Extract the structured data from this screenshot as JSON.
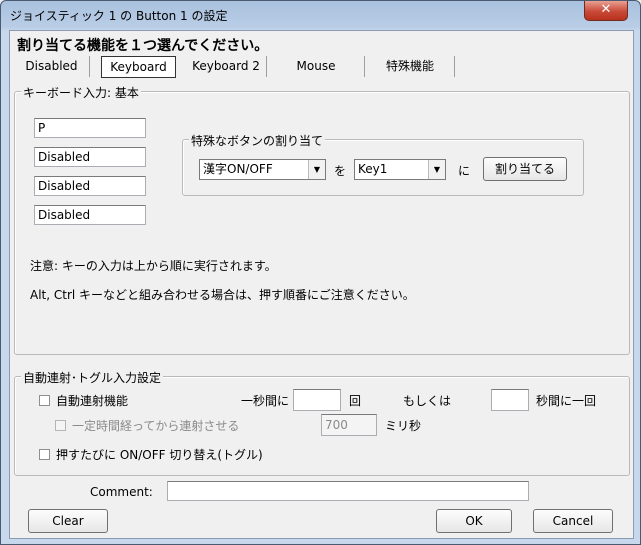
{
  "window": {
    "title": "ジョイスティック 1 の Button 1 の設定",
    "close_glyph": "✕"
  },
  "heading": "割り当てる機能を１つ選んでください。",
  "tabs": [
    {
      "label": "Disabled"
    },
    {
      "label": "Keyboard"
    },
    {
      "label": "Keyboard 2"
    },
    {
      "label": "Mouse"
    },
    {
      "label": "特殊機能"
    }
  ],
  "keyboard_group": {
    "title": "キーボード入力: 基本",
    "keys": [
      "P",
      "Disabled",
      "Disabled",
      "Disabled"
    ],
    "special": {
      "title": "特殊なボタンの割り当て",
      "combo1": "漢字ON/OFF",
      "wo": "を",
      "combo2": "Key1",
      "ni": "に",
      "assign_label": "割り当てる"
    },
    "note1": "注意: キーの入力は上から順に実行されます。",
    "note2": "Alt, Ctrl キーなどと組み合わせる場合は、押す順番にご注意ください。"
  },
  "auto_group": {
    "title": "自動連射･トグル入力設定",
    "auto_fire_label": "自動連射機能",
    "per_second_label": "一秒間に",
    "times_label": "回",
    "or_label": "もしくは",
    "seconds_once_label": "秒間に一回",
    "delay_label": "一定時間経ってから連射させる",
    "delay_value": "700",
    "ms_label": "ミリ秒",
    "toggle_label": "押すたびに ON/OFF 切り替え(トグル)"
  },
  "comment_label": "Comment:",
  "buttons": {
    "clear": "Clear",
    "ok": "OK",
    "cancel": "Cancel"
  }
}
